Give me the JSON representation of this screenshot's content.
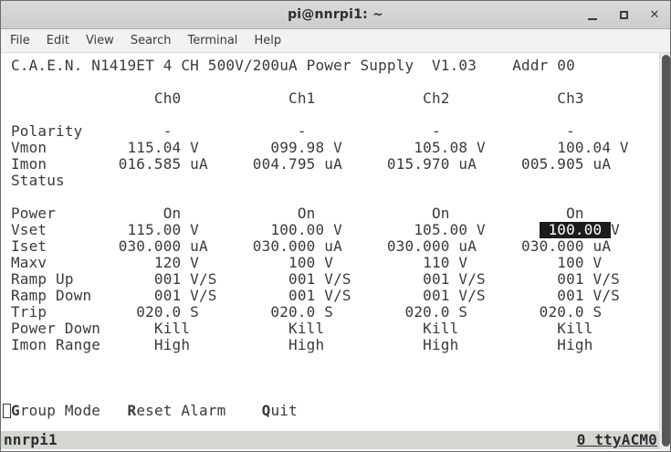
{
  "window": {
    "title": "pi@nnrpi1: ~"
  },
  "menubar": {
    "items": [
      "File",
      "Edit",
      "View",
      "Search",
      "Terminal",
      "Help"
    ]
  },
  "table": {
    "device_header": "C.A.E.N.  N1419ET 4 CH 500V/200uA  Power Supply  V1.03  Addr 00",
    "columns": [
      "Ch0",
      "Ch1",
      "Ch2",
      "Ch3"
    ],
    "rows": [
      {
        "label": "Polarity",
        "values": [
          "-",
          "-",
          "-",
          "-"
        ]
      },
      {
        "label": "Vmon",
        "values": [
          "115.04 V",
          "099.98 V",
          "105.08 V",
          "100.04 V"
        ]
      },
      {
        "label": "Imon",
        "values": [
          "016.585 uA",
          "004.795 uA",
          "015.970 uA",
          "005.905 uA"
        ]
      },
      {
        "label": "Status",
        "values": [
          "",
          "",
          "",
          ""
        ]
      },
      {
        "label": "Power",
        "values": [
          "On",
          "On",
          "On",
          "On"
        ]
      },
      {
        "label": "Vset",
        "values": [
          "115.00 V",
          "100.00 V",
          "105.00 V",
          "100.00 V"
        ],
        "selected_column": "Ch3"
      },
      {
        "label": "Iset",
        "values": [
          "030.000 uA",
          "030.000 uA",
          "030.000 uA",
          "030.000 uA"
        ]
      },
      {
        "label": "Maxv",
        "values": [
          "120 V",
          "100 V",
          "110 V",
          "100 V"
        ]
      },
      {
        "label": "Ramp Up",
        "values": [
          "001 V/S",
          "001 V/S",
          "001 V/S",
          "001 V/S"
        ]
      },
      {
        "label": "Ramp Down",
        "values": [
          "001 V/S",
          "001 V/S",
          "001 V/S",
          "001 V/S"
        ]
      },
      {
        "label": "Trip",
        "values": [
          "020.0 S",
          "020.0 S",
          "020.0 S",
          "020.0 S"
        ]
      },
      {
        "label": "Power Down",
        "values": [
          "Kill",
          "Kill",
          "Kill",
          "Kill"
        ]
      },
      {
        "label": "Imon Range",
        "values": [
          "High",
          "High",
          "High",
          "High"
        ]
      }
    ]
  },
  "lines": {
    "header": "C.A.E.N. N1419ET 4 CH 500V/200uA Power Supply  V1.03    Addr 00",
    "channels": "                Ch0            Ch1            Ch2            Ch3",
    "polarity": "Polarity         -              -              -              -",
    "vmon": "Vmon         115.04 V        099.98 V        105.08 V        100.04 V",
    "imon": "Imon        016.585 uA     004.795 uA     015.970 uA     005.905 uA",
    "status": "Status",
    "power": "Power            On             On             On             On",
    "vset_pre": "Vset         115.00 V        100.00 V        105.00 V      ",
    "vset_hl": " 100.00 ",
    "vset_post": "V      ",
    "iset": "Iset        030.000 uA     030.000 uA     030.000 uA     030.000 uA",
    "maxv": "Maxv            120 V          100 V          110 V          100 V",
    "ramp_up": "Ramp Up         001 V/S        001 V/S        001 V/S        001 V/S",
    "ramp_down": "Ramp Down       001 V/S        001 V/S        001 V/S        001 V/S",
    "trip": "Trip          020.0 S        020.0 S        020.0 S        020.0 S",
    "power_down": "Power Down      Kill           Kill           Kill           Kill",
    "imon_range": "Imon Range      High           High           High           High"
  },
  "command_menu": {
    "group_key": "G",
    "group_rest": "roup Mode   ",
    "reset_key": "R",
    "reset_rest": "eset Alarm    ",
    "quit_key": "Q",
    "quit_rest": "uit"
  },
  "status_bar": {
    "left": "nnrpi1",
    "right": "0 ttyACM0"
  }
}
